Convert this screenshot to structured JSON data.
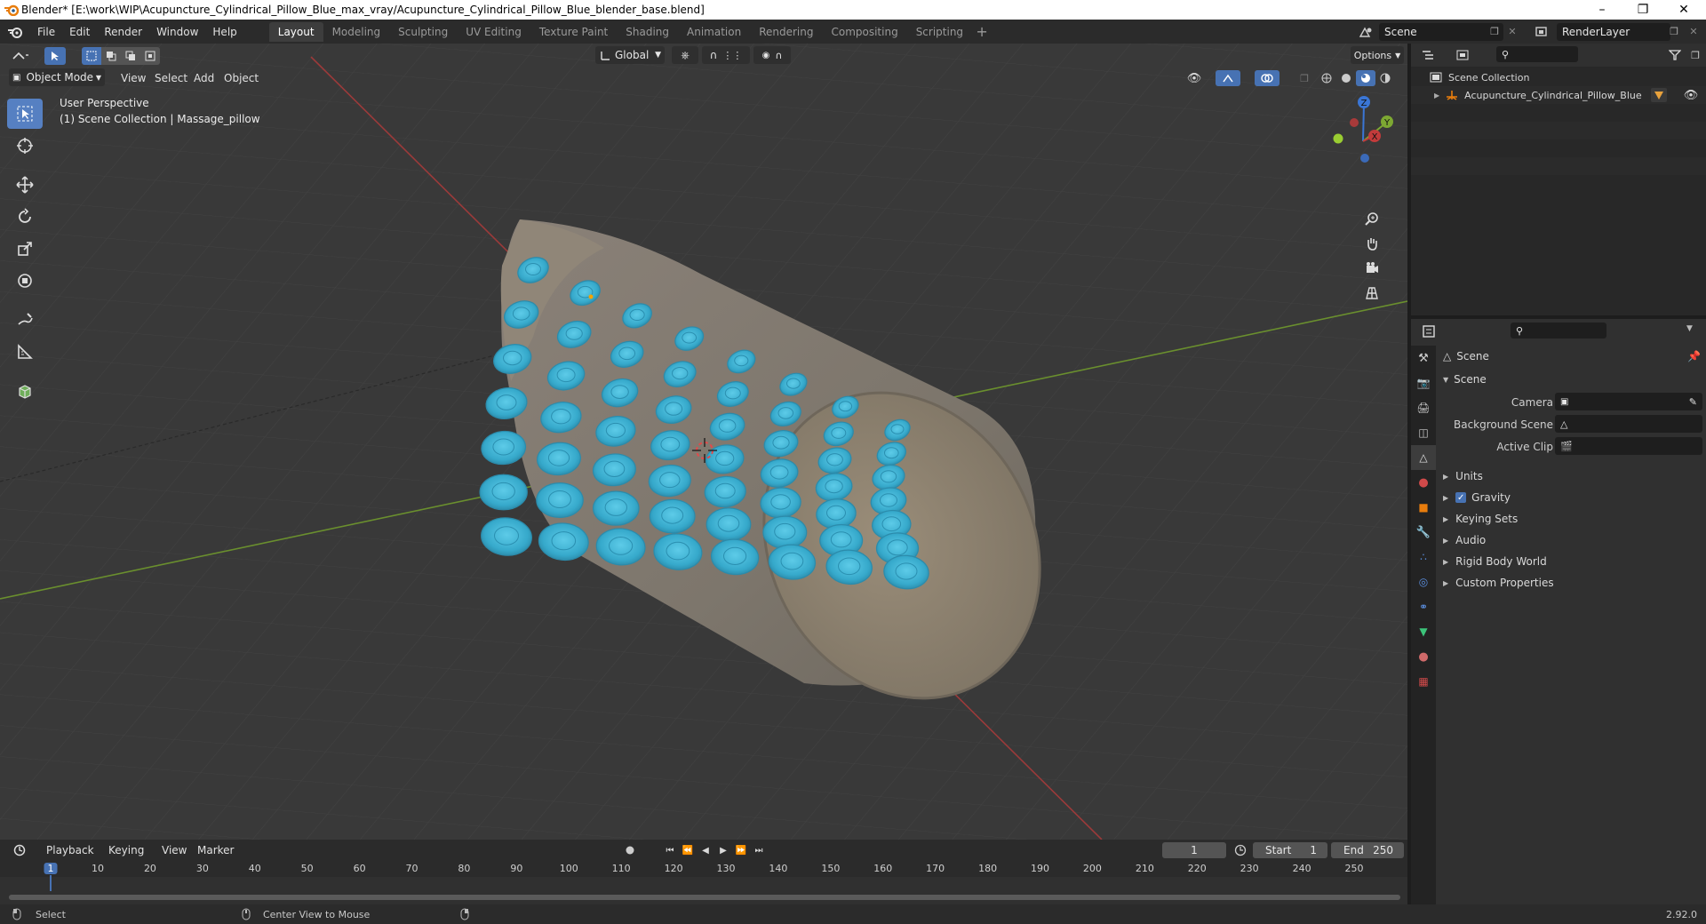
{
  "window": {
    "title": "Blender* [E:\\work\\WIP\\Acupuncture_Cylindrical_Pillow_Blue_max_vray/Acupuncture_Cylindrical_Pillow_Blue_blender_base.blend]"
  },
  "menu": [
    "File",
    "Edit",
    "Render",
    "Window",
    "Help"
  ],
  "workspaces": [
    {
      "label": "Layout",
      "active": true
    },
    {
      "label": "Modeling",
      "active": false
    },
    {
      "label": "Sculpting",
      "active": false
    },
    {
      "label": "UV Editing",
      "active": false
    },
    {
      "label": "Texture Paint",
      "active": false
    },
    {
      "label": "Shading",
      "active": false
    },
    {
      "label": "Animation",
      "active": false
    },
    {
      "label": "Rendering",
      "active": false
    },
    {
      "label": "Compositing",
      "active": false
    },
    {
      "label": "Scripting",
      "active": false
    }
  ],
  "topbar": {
    "scene_name": "Scene",
    "view_layer": "RenderLayer"
  },
  "viewport": {
    "transform_orientation": "Global",
    "options_label": "Options",
    "mode": "Object Mode",
    "header_menu": [
      "View",
      "Select",
      "Add",
      "Object"
    ],
    "overlay_line1": "User Perspective",
    "overlay_line2": "(1) Scene Collection | Massage_pillow",
    "gizmo_axes": {
      "z": "Z",
      "y": "Y",
      "x": "X"
    }
  },
  "outliner": {
    "root": "Scene Collection",
    "items": [
      "Acupuncture_Cylindrical_Pillow_Blue"
    ]
  },
  "properties": {
    "context_label": "Scene",
    "panel_title": "Scene",
    "fields": {
      "camera_label": "Camera",
      "background_scene_label": "Background Scene",
      "active_clip_label": "Active Clip"
    },
    "subpanels": [
      "Units",
      "Gravity",
      "Keying Sets",
      "Audio",
      "Rigid Body World",
      "Custom Properties"
    ],
    "gravity_checked": true
  },
  "timeline": {
    "menu": [
      "Playback",
      "Keying",
      "View",
      "Marker"
    ],
    "current_frame": "1",
    "start_label": "Start",
    "start_value": "1",
    "end_label": "End",
    "end_value": "250",
    "ticks": [
      "1",
      "10",
      "20",
      "30",
      "40",
      "50",
      "60",
      "70",
      "80",
      "90",
      "100",
      "110",
      "120",
      "130",
      "140",
      "150",
      "160",
      "170",
      "180",
      "190",
      "200",
      "210",
      "220",
      "230",
      "240",
      "250"
    ]
  },
  "statusbar": {
    "left": "Select",
    "middle": "Center View to Mouse",
    "version": "2.92.0"
  },
  "colors": {
    "accent": "#4772b3",
    "active_tool": "#5680c2",
    "x_axis": "#c23b3b",
    "y_axis": "#7da832",
    "z_axis": "#3a76d6",
    "nodule_blue": "#3fb4d6",
    "fabric": "#8c8273"
  }
}
